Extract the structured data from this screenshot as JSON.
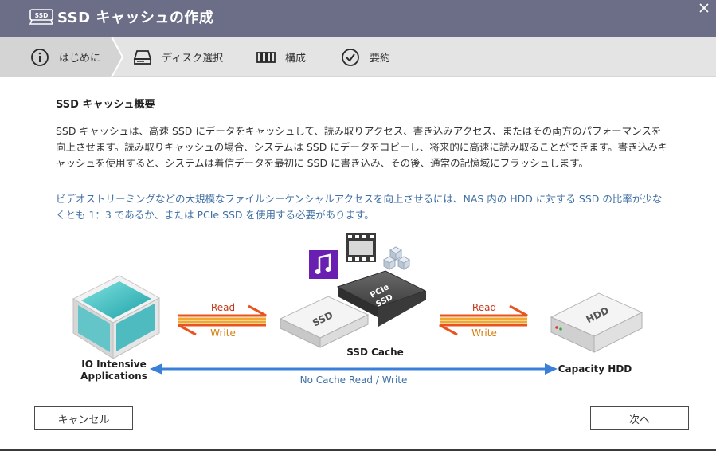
{
  "window": {
    "title": "SSD キャッシュの作成",
    "icon": "ssd-icon",
    "close_icon": "close-icon"
  },
  "steps": [
    {
      "label": "はじめに",
      "icon": "info-icon",
      "active": true
    },
    {
      "label": "ディスク選択",
      "icon": "disk-icon",
      "active": false
    },
    {
      "label": "構成",
      "icon": "raid-icon",
      "active": false
    },
    {
      "label": "要約",
      "icon": "check-circle-icon",
      "active": false
    }
  ],
  "main": {
    "section_title": "SSD キャッシュ概要",
    "description": "SSD キャッシュは、高速 SSD にデータをキャッシュして、読み取りアクセス、書き込みアクセス、またはその両方のパフォーマンスを向上させます。読み取りキャッシュの場合、システムは SSD にデータをコピーし、将来的に高速に読み取ることができます。書き込みキャッシュを使用すると、システムは着信データを最初に SSD に書き込み、その後、通常の記憶域にフラッシュします。",
    "note": "ビデオストリーミングなどの大規模なファイルシーケンシャルアクセスを向上させるには、NAS 内の HDD に対する SSD の比率が少なくとも 1：3 であるか、または PCIe SSD を使用する必要があります。"
  },
  "diagram": {
    "left_label_1": "IO Intensive",
    "left_label_2": "Applications",
    "read_label_1": "Read",
    "write_label_1": "Write",
    "ssd_text": "SSD",
    "pcie_text_1": "PCIe",
    "pcie_text_2": "SSD",
    "cache_label": "SSD Cache",
    "read_label_2": "Read",
    "write_label_2": "Write",
    "hdd_text": "HDD",
    "right_label": "Capacity HDD",
    "bottom_label": "No Cache Read / Write",
    "colors": {
      "read": "#e8531f",
      "write": "#f0a830",
      "bypass": "#3a7fd8",
      "music": "#6a1fb3",
      "label_blue": "#3f6fa3"
    }
  },
  "footer": {
    "cancel_label": "キャンセル",
    "next_label": "次へ"
  }
}
